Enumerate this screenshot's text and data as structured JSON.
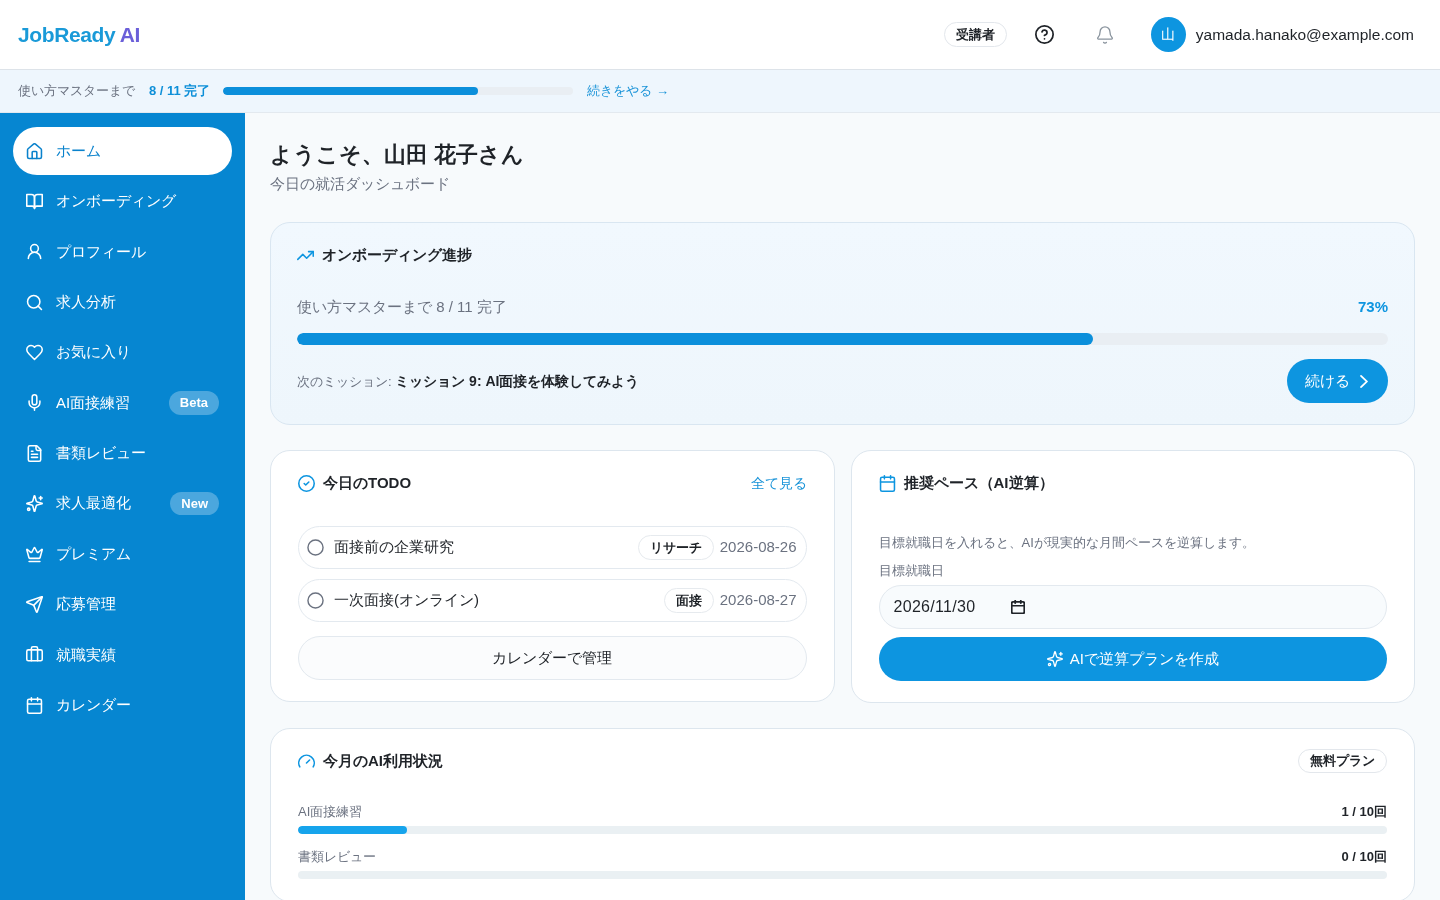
{
  "header": {
    "logo": "JobReady",
    "logo_accent": "AI",
    "role": "受講者",
    "avatar": "山",
    "email": "yamada.hanako@example.com"
  },
  "progress_strip": {
    "label": "使い方マスターまで",
    "count": "8 / 11 完了",
    "level": 0.727,
    "link": "続きをやる →"
  },
  "sidebar": {
    "items": [
      {
        "label": "ホーム",
        "selected": true
      },
      {
        "label": "オンボーディング",
        "selected": false
      },
      {
        "label": "プロフィール",
        "selected": false
      },
      {
        "label": "求人分析",
        "selected": false
      },
      {
        "label": "お気に入り",
        "selected": false
      },
      {
        "label": "AI面接練習",
        "badge": "Beta",
        "selected": false
      },
      {
        "label": "書類レビュー",
        "selected": false
      },
      {
        "label": "求人最適化",
        "badge": "New",
        "selected": false
      },
      {
        "label": "プレミアム",
        "selected": false
      },
      {
        "label": "応募管理",
        "selected": false
      },
      {
        "label": "就職実績",
        "selected": false
      },
      {
        "label": "カレンダー",
        "selected": false
      }
    ]
  },
  "page": {
    "title": "ようこそ、山田 花子さん",
    "subtitle": "今日の就活ダッシュボード"
  },
  "onboarding": {
    "title": "オンボーディング進捗",
    "progress_label": "使い方マスターまで 8 / 11 完了",
    "percent": "73%",
    "level": 0.73,
    "next_mission": "次のミッション: **ミッション 9: AI面接を体験してみよう**",
    "button": "続ける"
  },
  "todo": {
    "title": "今日のTODO",
    "link": "全て見る",
    "items": [
      {
        "title": "面接前の企業研究",
        "tag": "リサーチ",
        "date": "2026-08-26",
        "checked": false
      },
      {
        "title": "一次面接(オンライン)",
        "tag": "面接",
        "date": "2026-08-27",
        "checked": false
      }
    ],
    "button": "カレンダーで管理"
  },
  "pace": {
    "title": "推奨ペース（AI逆算）",
    "description": "目標就職日を入れると、AIが現実的な月間ペースを逆算します。",
    "field_label": "目標就職日",
    "date": "2026/11/30",
    "button": "AIで逆算プランを作成"
  },
  "usage": {
    "title": "今月のAI利用状況",
    "plan": "無料プラン",
    "rows": [
      {
        "label": "AI面接練習",
        "count": "1 / 10回",
        "level": 0.1
      },
      {
        "label": "書類レビュー",
        "count": "0 / 10回",
        "level": 0
      }
    ]
  }
}
